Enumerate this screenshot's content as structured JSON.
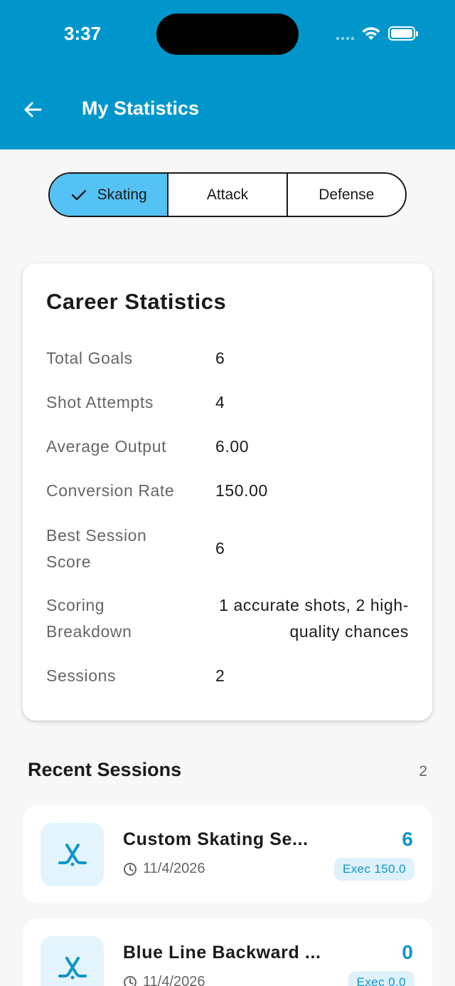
{
  "status_bar": {
    "time": "3:37"
  },
  "header": {
    "title": "My Statistics",
    "back_icon": "arrow-left-icon"
  },
  "segments": [
    {
      "label": "Skating",
      "selected": true
    },
    {
      "label": "Attack",
      "selected": false
    },
    {
      "label": "Defense",
      "selected": false
    }
  ],
  "career": {
    "title": "Career Statistics",
    "rows": [
      {
        "label": "Total Goals",
        "value": "6"
      },
      {
        "label": "Shot Attempts",
        "value": "4"
      },
      {
        "label": "Average Output",
        "value": "6.00"
      },
      {
        "label": "Conversion Rate",
        "value": "150.00"
      },
      {
        "label": "Best Session Score",
        "value": "6"
      },
      {
        "label": "Scoring Breakdown",
        "value": "1 accurate shots, 2 high-quality chances"
      },
      {
        "label": "Sessions",
        "value": "2"
      }
    ]
  },
  "recent": {
    "title": "Recent Sessions",
    "count": "2",
    "sessions": [
      {
        "name": "Custom Skating Se...",
        "date": "11/4/2026",
        "score": "6",
        "badge": "Exec 150.0",
        "icon": "hockey-sticks-icon"
      },
      {
        "name": "Blue Line Backward ...",
        "date": "11/4/2026",
        "score": "0",
        "badge": "Exec 0.0",
        "icon": "hockey-sticks-icon"
      }
    ]
  },
  "colors": {
    "appbar": "#0096cc",
    "selected_segment": "#55c2f5",
    "accent": "#0e95c9"
  }
}
